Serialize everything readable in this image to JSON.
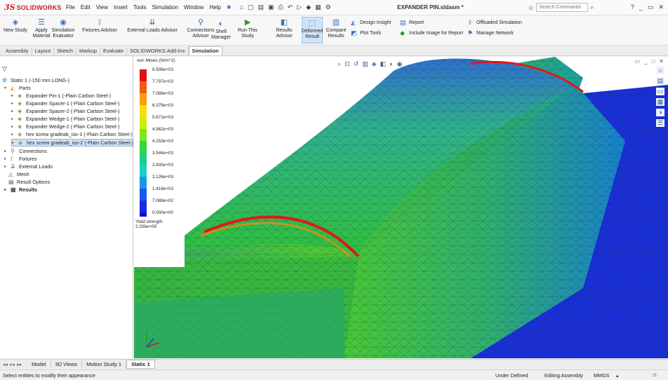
{
  "app": {
    "brand_ds": "3S",
    "brand_name": "SOLIDWORKS",
    "document_title": "EXPANDER PIN.sldasm *"
  },
  "menu": [
    "File",
    "Edit",
    "View",
    "Insert",
    "Tools",
    "Simulation",
    "Window",
    "Help"
  ],
  "search": {
    "placeholder": "Search Commands"
  },
  "ribbon": {
    "new_study": "New Study",
    "apply_material": "Apply Material",
    "simulation_evaluator": "Simulation Evaluator",
    "fixtures_advisor": "Fixtures Advisor",
    "external_loads_advisor": "External Loads Advisor",
    "connections_advisor": "Connections Advisor",
    "shell_manager": "Shell Manager",
    "run_this_study": "Run This Study",
    "results_advisor": "Results Advisor",
    "deformed_result": "Deformed Result",
    "compare_results": "Compare Results",
    "design_insight": "Design Insight",
    "plot_tools": "Plot Tools",
    "report": "Report",
    "include_image": "Include Image for Report",
    "offloaded_simulation": "Offloaded Simulation",
    "manage_network": "Manage Network"
  },
  "command_tabs": [
    "Assembly",
    "Layout",
    "Sketch",
    "Markup",
    "Evaluate",
    "SOLIDWORKS Add-Ins",
    "Simulation"
  ],
  "tree": {
    "study": "Static 1 (-150 mm LONG-)",
    "parts_label": "Parts",
    "parts": [
      "Expander Pin-1 (-Plain Carbon Steel-)",
      "Expander Spacer-1 (-Plain Carbon Steel-)",
      "Expander Spacer-2 (-Plain Carbon Steel-)",
      "Expander Wedge-1 (-Plain Carbon Steel-)",
      "Expander Wedge-2 (-Plain Carbon Steel-)",
      "hex screw gradeab_iso-1 (-Plain Carbon Steel-)",
      "hex screw gradeab_iso-2 (-Plain Carbon Steel-)"
    ],
    "connections": "Connections",
    "fixtures": "Fixtures",
    "external_loads": "External Loads",
    "mesh": "Mesh",
    "result_options": "Result Options",
    "results": "Results"
  },
  "legend": {
    "title": "von Mises (N/m^2)",
    "labels": [
      "8.508e+03",
      "7.797e+03",
      "7.088e+03",
      "6.379e+03",
      "5.671e+03",
      "4.962e+03",
      "4.253e+03",
      "3.544e+03",
      "2.835e+03",
      "2.126e+03",
      "1.418e+03",
      "7.088e+02",
      "0.000e+00"
    ],
    "colors": [
      "#e01010",
      "#f05a10",
      "#f8a010",
      "#f8e010",
      "#c8f010",
      "#7ae81a",
      "#30d840",
      "#18d088",
      "#18d0c8",
      "#1898e8",
      "#1858f0",
      "#1828e8",
      "#1010c8"
    ],
    "yield_strength": "Yield strength: 2.206e+08"
  },
  "bottom_tabs": [
    "Model",
    "3D Views",
    "Motion Study 1",
    "Static 1"
  ],
  "status": {
    "message": "Select entities to modify their appearance",
    "state": "Under Defined",
    "mode": "Editing Assembly",
    "units": "MMGS"
  }
}
